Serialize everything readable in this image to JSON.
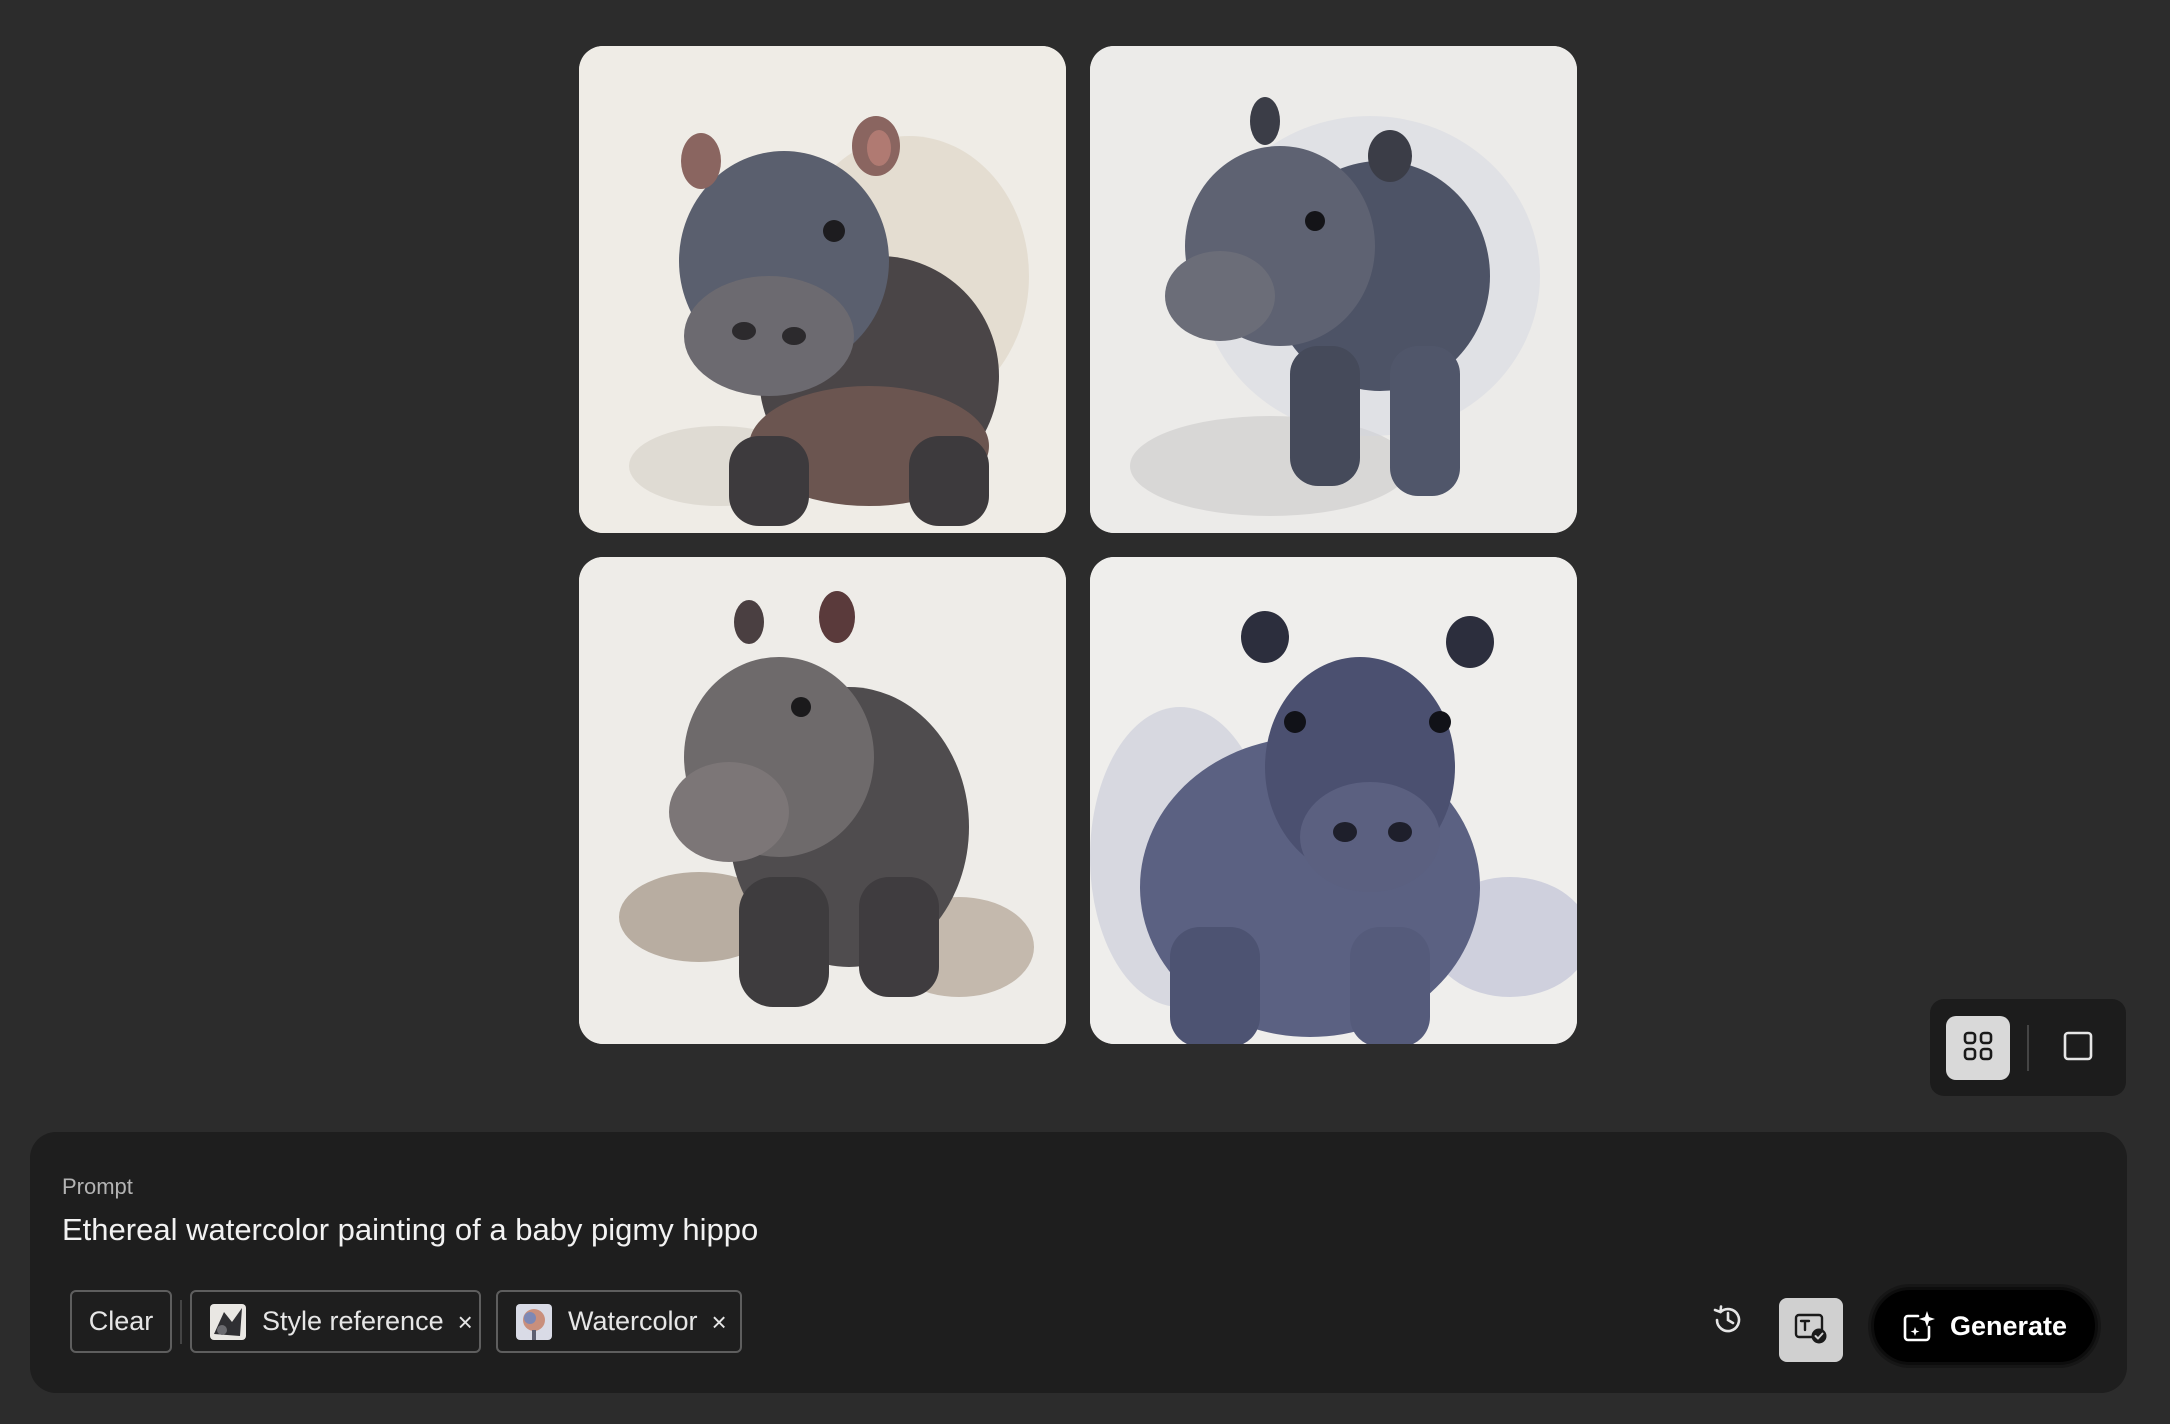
{
  "gallery": {
    "images": [
      {
        "name": "hippo-variation-1"
      },
      {
        "name": "hippo-variation-2"
      },
      {
        "name": "hippo-variation-3"
      },
      {
        "name": "hippo-variation-4"
      }
    ]
  },
  "view_toggle": {
    "selected": "grid",
    "grid_icon": "grid-view-icon",
    "single_icon": "single-view-icon"
  },
  "prompt": {
    "label": "Prompt",
    "text": "Ethereal watercolor painting of a baby pigmy hippo"
  },
  "chips": {
    "clear_label": "Clear",
    "style_reference_label": "Style reference",
    "watercolor_label": "Watercolor",
    "remove_glyph": "×"
  },
  "actions": {
    "history_icon": "history-icon",
    "credentials_icon": "content-credentials-icon",
    "generate_label": "Generate",
    "generate_icon": "generate-sparkle-icon"
  },
  "colors": {
    "background": "#2c2c2c",
    "panel": "#1e1e1e",
    "generate_button": "#000000"
  }
}
